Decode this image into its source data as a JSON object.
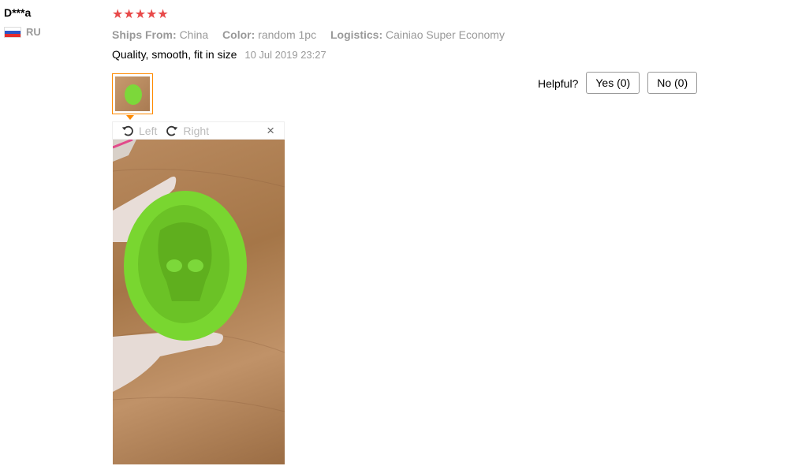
{
  "reviewer": {
    "name": "D***a",
    "country": "RU",
    "flag_colors": [
      "#ffffff",
      "#2b57c8",
      "#e52d2d"
    ]
  },
  "review": {
    "stars": "★★★★★",
    "rating": 5,
    "star_color": "#e84a4a",
    "ships_from_label": "Ships From:",
    "ships_from_value": "China",
    "color_label": "Color:",
    "color_value": "random 1pc",
    "logistics_label": "Logistics:",
    "logistics_value": "Cainiao Super Economy",
    "text": "Quality, smooth, fit in size",
    "date": "10 Jul 2019 23:27"
  },
  "viewer": {
    "rotate_left_label": "Left",
    "rotate_right_label": "Right",
    "close_glyph": "×",
    "accent_color": "#ff8a00"
  },
  "helpful": {
    "question": "Helpful?",
    "yes_label": "Yes (0)",
    "no_label": "No (0)"
  }
}
